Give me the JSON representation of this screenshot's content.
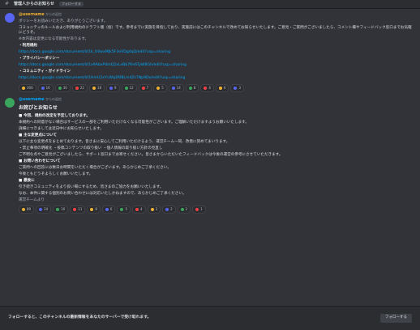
{
  "channel": {
    "name": "管理人からのお知らせ",
    "follow_label": "フォローする"
  },
  "first_message": {
    "author": "@username",
    "subtitle": "からの返信",
    "intro": "ポリシーをお読みいただき、ありがとうございます。",
    "paragraph": "コミュニティのルールおよび利用規約のドラフト版（仮）です。参考までに実施を目指しており、実施前にはこのチャンネルで改めてお知らせいたします。ご意見・ご質問がございましたら、コメント欄やフィードバック窓口までお気軽にどうぞ。",
    "note": "※本内容は変更になる可能性があります。",
    "sections": [
      {
        "label": "・利用規約",
        "url": "https://docs.google.com/document/d/1k_U0wxMJk5F3eVDg4qQ/edit?usp=sharing"
      },
      {
        "label": "・プライバシーポリシー",
        "url": "https://docs.google.com/document/d/1x9AbxP4mQ2xLvBb7Rn6TyW8Gh/edit?usp=sharing"
      },
      {
        "label": "・コミュニティ・ガイドライン",
        "url": "https://docs.google.com/document/d/1HmU2xYcWq3Rf8Lm4Zs7Np9Dv/edit?usp=sharing"
      }
    ],
    "reactions": [
      {
        "emoji": "1",
        "count": "306"
      },
      {
        "emoji": "2",
        "count": "16"
      },
      {
        "emoji": "3",
        "count": "30"
      },
      {
        "emoji": "4",
        "count": "22"
      },
      {
        "emoji": "5",
        "count": "18"
      },
      {
        "emoji": "6",
        "count": "9"
      },
      {
        "emoji": "7",
        "count": "12"
      },
      {
        "emoji": "8",
        "count": "7"
      },
      {
        "emoji": "9",
        "count": "5"
      },
      {
        "emoji": "10",
        "count": "14"
      },
      {
        "emoji": "11",
        "count": "8"
      },
      {
        "emoji": "12",
        "count": "4"
      },
      {
        "emoji": "13",
        "count": "6"
      },
      {
        "emoji": "14",
        "count": "3"
      }
    ]
  },
  "second_message": {
    "author": "@username",
    "subtitle": "からの返信",
    "heading": "お詫びとお知らせ",
    "q1": "■ 今回、規約の改定を予定しております。",
    "p1": "本規約への同意がない場合はサービスの一部をご利用いただけなくなる可能性がございます。ご理解いただけますようお願いいたします。",
    "p2": "詳細につきましては近日中にお知らせいたします。",
    "q2": "■ 主な変更点について",
    "p3": "以下に主な変更点をまとめております。皆さまに安心してご利用いただけるよう、運営チーム一同、改善に努めてまいります。",
    "p4": "・禁止事項の明確化 ・投稿コンテンツの取り扱い ・個人情報の取り扱い方針の見直し",
    "p5": "ご不明な点やご意見がございましたら、サポート窓口までお寄せください。皆さまからいただいたフィードバックは今後の運営の参考にさせていただきます。",
    "q3": "■ お問い合わせについて",
    "p6": "ご質問への回答には数日お時間をいただく場合がございます。あらかじめご了承ください。",
    "p7": "今後ともどうぞよろしくお願いいたします。",
    "q4": "■ 最後に",
    "p8": "引き続きコミュニティをより良い場にするため、皆さまのご協力をお願いいたします。",
    "p9": "なお、本件に関する個別のお問い合わせには対応いたしかねますので、あらかじめご了承ください。",
    "p10": "運営チームより",
    "reactions": [
      {
        "emoji": "1",
        "count": "89"
      },
      {
        "emoji": "2",
        "count": "24"
      },
      {
        "emoji": "3",
        "count": "16"
      },
      {
        "emoji": "4",
        "count": "11"
      },
      {
        "emoji": "5",
        "count": "8"
      },
      {
        "emoji": "6",
        "count": "6"
      },
      {
        "emoji": "7",
        "count": "5"
      },
      {
        "emoji": "8",
        "count": "4"
      },
      {
        "emoji": "9",
        "count": "3"
      },
      {
        "emoji": "10",
        "count": "2"
      },
      {
        "emoji": "11",
        "count": "2"
      },
      {
        "emoji": "12",
        "count": "1"
      }
    ]
  },
  "bottom": {
    "notice": "フォローすると、このチャンネルの最新情報をあなたのサーバーで受け取れます。",
    "button": "フォローする"
  },
  "colors": {
    "background": "#313338",
    "accent": "#5865f2",
    "link": "#00a8fc",
    "author": "#f0b232"
  }
}
